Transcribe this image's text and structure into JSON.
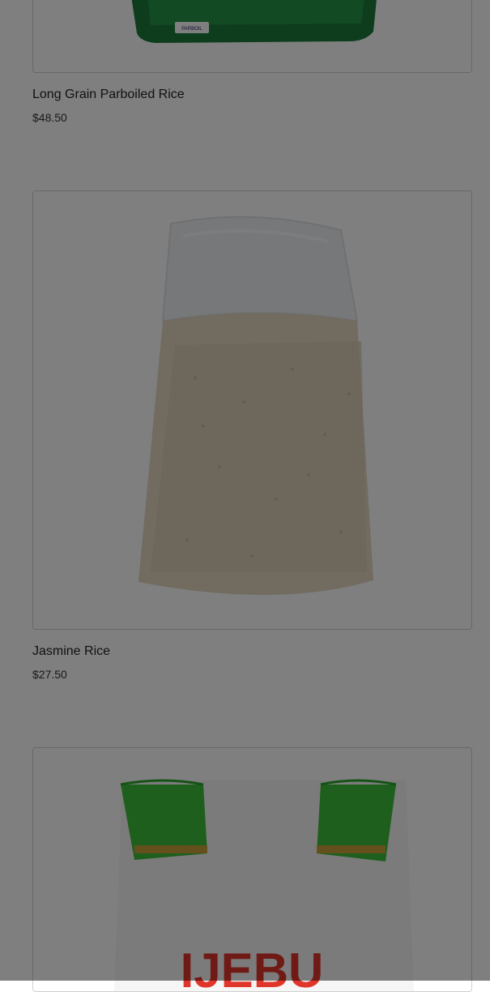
{
  "products": [
    {
      "title": "Long Grain Parboiled Rice",
      "price": "$48.50",
      "bag_label": "PARBOIL"
    },
    {
      "title": "Jasmine Rice",
      "price": "$27.50"
    },
    {
      "title": "",
      "price": "",
      "bag_label": "IJEBU"
    }
  ],
  "colors": {
    "overlay": "rgba(0,0,0,0.5)",
    "green_bag": "#1a7a3a",
    "zip_green": "#3cc43a",
    "brand_red": "#e0352b"
  }
}
